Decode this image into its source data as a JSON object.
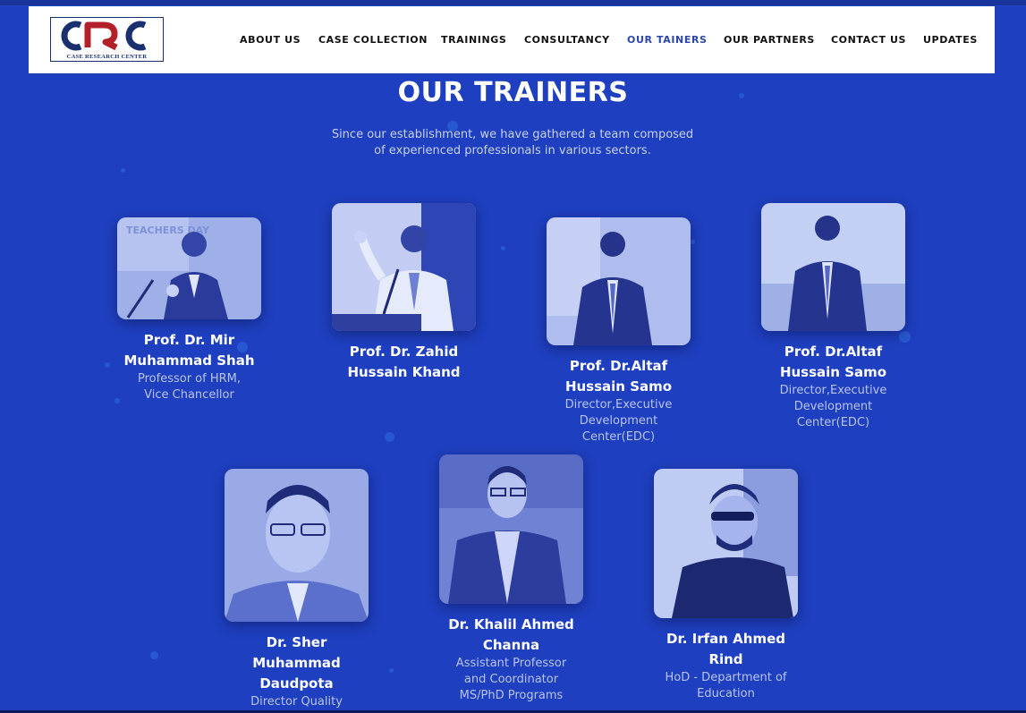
{
  "logo": {
    "text": "CRC",
    "subtitle": "CASE RESEARCH CENTER"
  },
  "nav": {
    "items": [
      {
        "label": "ABOUT US"
      },
      {
        "label": "CASE COLLECTION"
      },
      {
        "label": "TRAININGS"
      },
      {
        "label": "CONSULTANCY"
      },
      {
        "label": "OUR TAINERS"
      },
      {
        "label": "OUR PARTNERS"
      },
      {
        "label": "CONTACT US"
      },
      {
        "label": "UPDATES"
      }
    ],
    "active": "OUR TAINERS"
  },
  "section": {
    "title": "OUR TRAINERS",
    "intro_line1": "Since our establishment, we have gathered a team composed",
    "intro_line2": "of experienced professionals in various sectors."
  },
  "trainers": [
    {
      "name": "Prof. Dr. Mir Muhammad Shah",
      "role": "Professor of HRM, Vice Chancellor"
    },
    {
      "name": "Prof. Dr. Zahid Hussain Khand",
      "role": ""
    },
    {
      "name": "Prof. Dr.Altaf Hussain Samo",
      "role": "Director,Executive Development Center(EDC)"
    },
    {
      "name": "Prof. Dr.Altaf Hussain Samo",
      "role": "Director,Executive Development Center(EDC)"
    },
    {
      "name": "Dr. Sher Muhammad Daudpota",
      "role": "Director Quality"
    },
    {
      "name": "Dr. Khalil Ahmed Channa",
      "role": "Assistant Professor and Coordinator MS/PhD Programs"
    },
    {
      "name": "Dr. Irfan Ahmed Rind",
      "role": "HoD - Department of Education"
    }
  ],
  "photo_labels": {
    "backdrop_text": "TEACHERS DAY"
  },
  "colors": {
    "background": "#1e3fbf",
    "nav_active": "#2b46b0",
    "logo_blue": "#1a2f6e",
    "logo_red": "#b3202a"
  }
}
